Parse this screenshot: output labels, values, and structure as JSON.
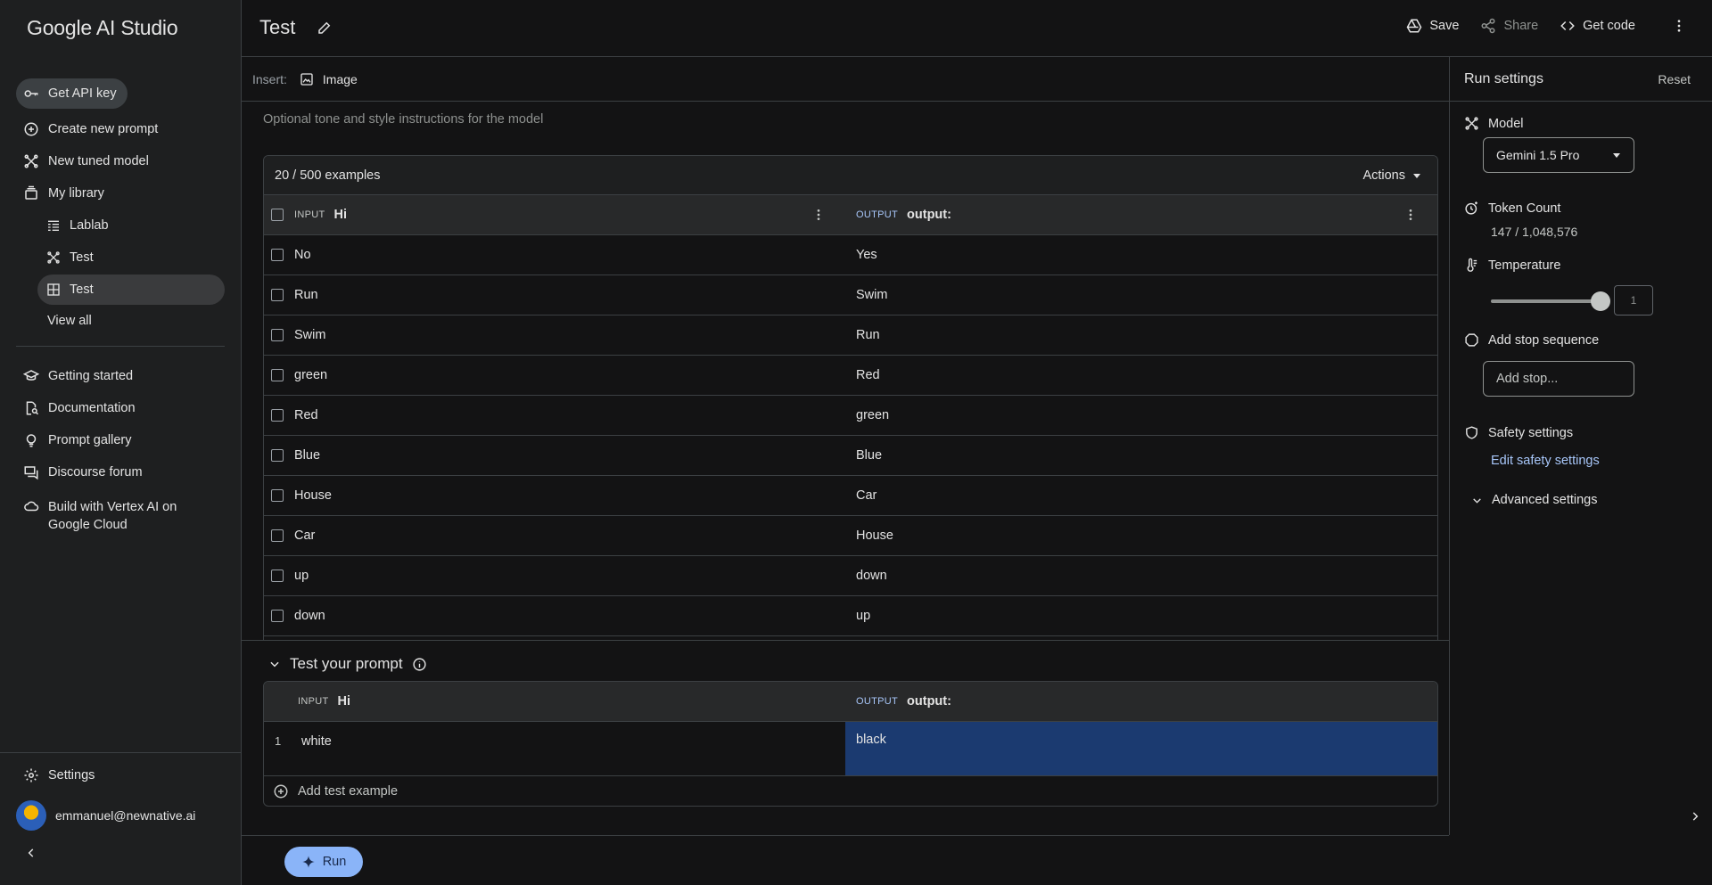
{
  "app": {
    "title": "Google AI Studio"
  },
  "sidebar": {
    "items": [
      {
        "label": "Get API key",
        "icon": "key-icon"
      },
      {
        "label": "Create new prompt",
        "icon": "plus-circle-icon"
      },
      {
        "label": "New tuned model",
        "icon": "tune-icon"
      },
      {
        "label": "My library",
        "icon": "library-icon"
      }
    ],
    "library": [
      {
        "label": "Lablab",
        "icon": "document-list-icon"
      },
      {
        "label": "Test",
        "icon": "tune-icon"
      },
      {
        "label": "Test",
        "icon": "grid-icon"
      }
    ],
    "view_all": "View all",
    "resources": [
      {
        "label": "Getting started",
        "icon": "graduation-cap-icon"
      },
      {
        "label": "Documentation",
        "icon": "doc-search-icon"
      },
      {
        "label": "Prompt gallery",
        "icon": "lightbulb-icon"
      },
      {
        "label": "Discourse forum",
        "icon": "forum-icon"
      },
      {
        "label": "Build with Vertex AI on Google Cloud",
        "icon": "cloud-icon"
      }
    ],
    "settings": "Settings",
    "user_email": "emmanuel@newnative.ai"
  },
  "header": {
    "title": "Test",
    "save": "Save",
    "share": "Share",
    "get_code": "Get code"
  },
  "insert": {
    "label": "Insert:",
    "image": "Image"
  },
  "system_instructions_placeholder": "Optional tone and style instructions for the model",
  "examples": {
    "count": "20 / 500 examples",
    "actions": "Actions",
    "input_tag": "INPUT",
    "output_tag": "OUTPUT",
    "input_header": "Hi",
    "output_header": "output:",
    "rows": [
      {
        "input": "No",
        "output": "Yes"
      },
      {
        "input": "Run",
        "output": "Swim"
      },
      {
        "input": "Swim",
        "output": "Run"
      },
      {
        "input": "green",
        "output": "Red"
      },
      {
        "input": "Red",
        "output": "green"
      },
      {
        "input": "Blue",
        "output": "Blue"
      },
      {
        "input": "House",
        "output": "Car"
      },
      {
        "input": "Car",
        "output": "House"
      },
      {
        "input": "up",
        "output": "down"
      },
      {
        "input": "down",
        "output": "up"
      }
    ]
  },
  "test": {
    "title": "Test your prompt",
    "input_tag": "INPUT",
    "output_tag": "OUTPUT",
    "input_header": "Hi",
    "output_header": "output:",
    "row_number": "1",
    "row_input": "white",
    "row_output": "black",
    "add_label": "Add test example"
  },
  "run": {
    "label": "Run"
  },
  "run_settings": {
    "title": "Run settings",
    "reset": "Reset",
    "model_label": "Model",
    "model_value": "Gemini 1.5 Pro",
    "token_label": "Token Count",
    "token_value": "147 / 1,048,576",
    "temperature_label": "Temperature",
    "temperature_value": "1",
    "temperature_level": 1.0,
    "stop_label": "Add stop sequence",
    "stop_placeholder": "Add stop...",
    "safety_label": "Safety settings",
    "safety_link": "Edit safety settings",
    "advanced_label": "Advanced settings"
  },
  "colors": {
    "accent": "#8ab4f8",
    "link": "#a8c7fa",
    "highlight": "#1b3a70",
    "bg": "#131314",
    "sidebar": "#1e1f20"
  }
}
